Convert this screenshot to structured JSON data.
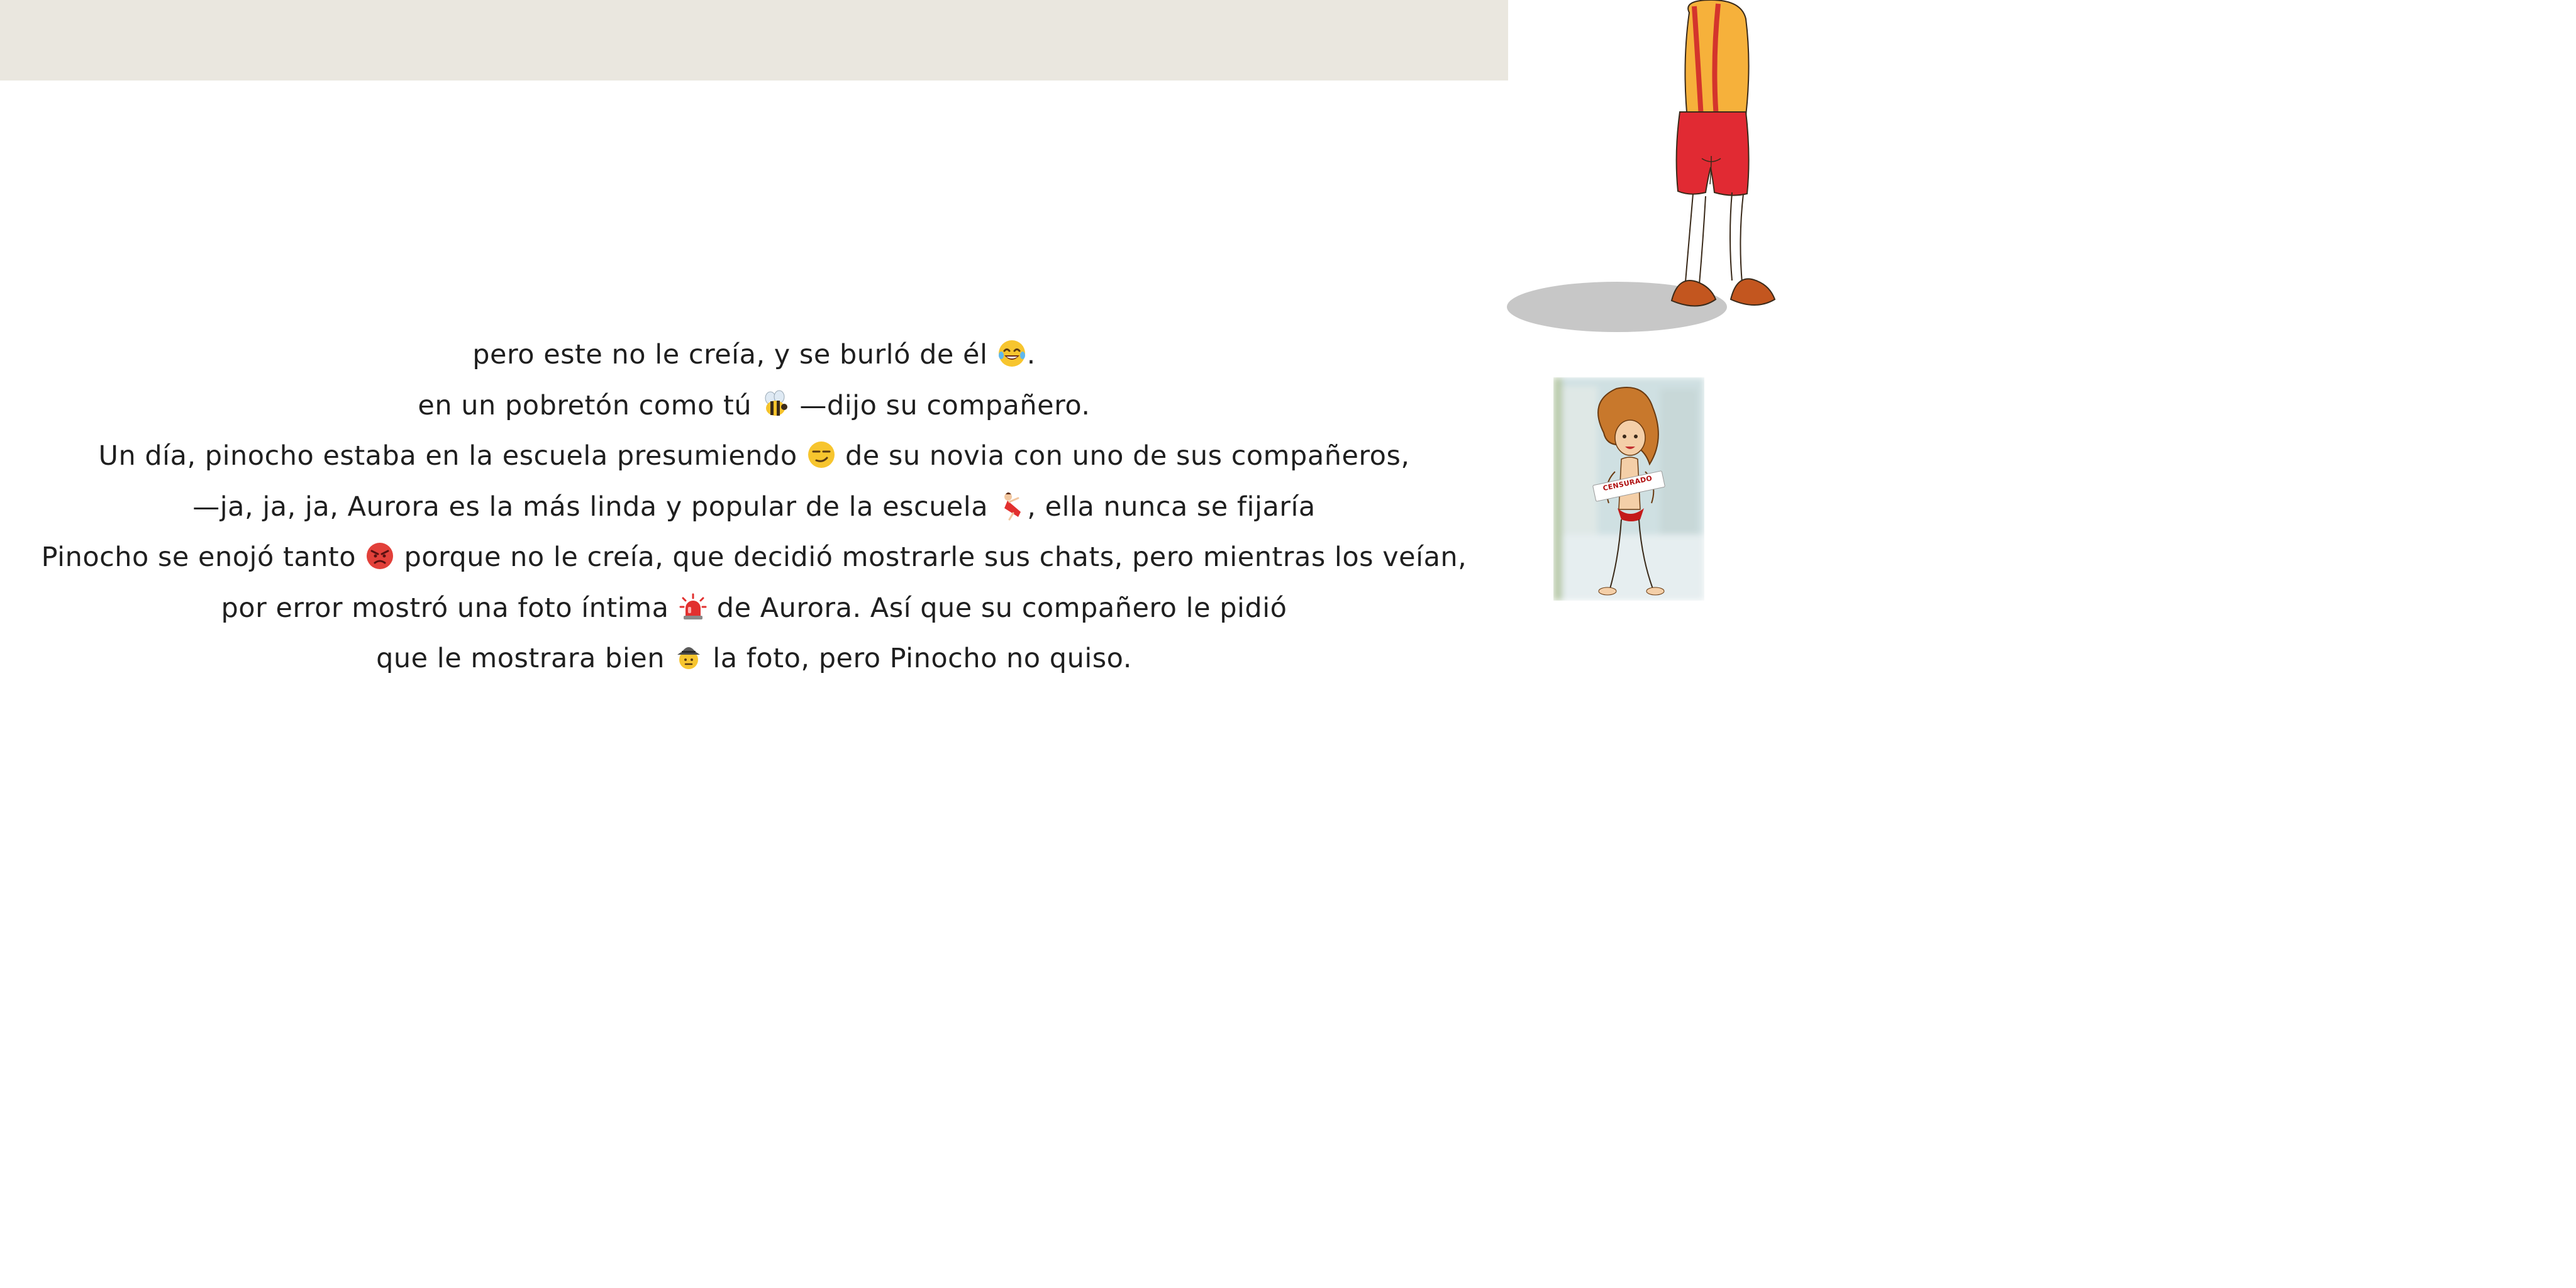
{
  "story": {
    "lines": [
      {
        "before": "pero este no le creía, y se burló de él ",
        "emoji": "laughing-crying-emoji",
        "after": "."
      },
      {
        "before": "en un pobretón como tú ",
        "emoji": "bee-emoji",
        "after": " —dijo su compañero."
      },
      {
        "before": "Un día, pinocho estaba en la escuela presumiendo ",
        "emoji": "smirk-emoji",
        "after": " de su novia con uno de sus compañeros,"
      },
      {
        "before": "—ja, ja, ja, Aurora es la más linda y popular de la escuela ",
        "emoji": "dancer-emoji",
        "after": ", ella nunca se fijaría"
      },
      {
        "before": "Pinocho se enojó tanto ",
        "emoji": "angry-face-emoji",
        "after": " porque no le creía, que decidió mostrarle sus chats, pero mientras los veían,"
      },
      {
        "before": "por error mostró una foto íntima ",
        "emoji": "siren-emoji",
        "after": " de Aurora. Así que su compañero le pidió"
      },
      {
        "before": "que le mostrara bien ",
        "emoji": "detective-emoji",
        "after": " la foto, pero Pinocho no quiso."
      }
    ]
  },
  "thumbnail": {
    "label": "CENSURADO"
  },
  "colors": {
    "top_band": "#eae7df",
    "text": "#1f1f1f",
    "suspenders": "#d4342c",
    "shirt": "#f6b13b",
    "shorts": "#e12a33",
    "shoes": "#c3561f",
    "shadow": "#c7c7c7"
  }
}
